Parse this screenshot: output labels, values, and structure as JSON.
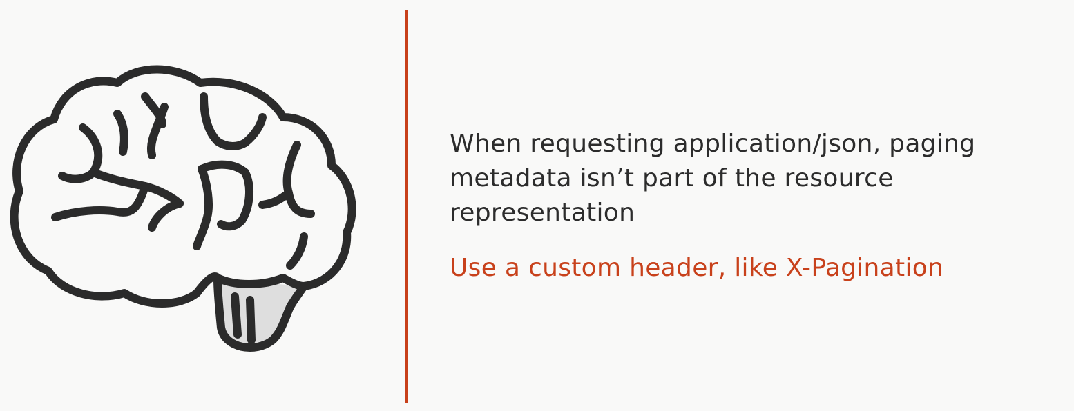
{
  "slide": {
    "statement_lines": [
      "When requesting application/json, paging",
      "metadata isn’t part of the resource",
      "representation"
    ],
    "highlight": "Use a custom header, like X-Pagination"
  },
  "icons": {
    "brain": "brain-icon"
  },
  "colors": {
    "background": "#f9f9f8",
    "accent": "#c8411b",
    "text": "#2c2c2c",
    "icon_stroke": "#2b2b2b",
    "stem_fill": "#dedede"
  }
}
